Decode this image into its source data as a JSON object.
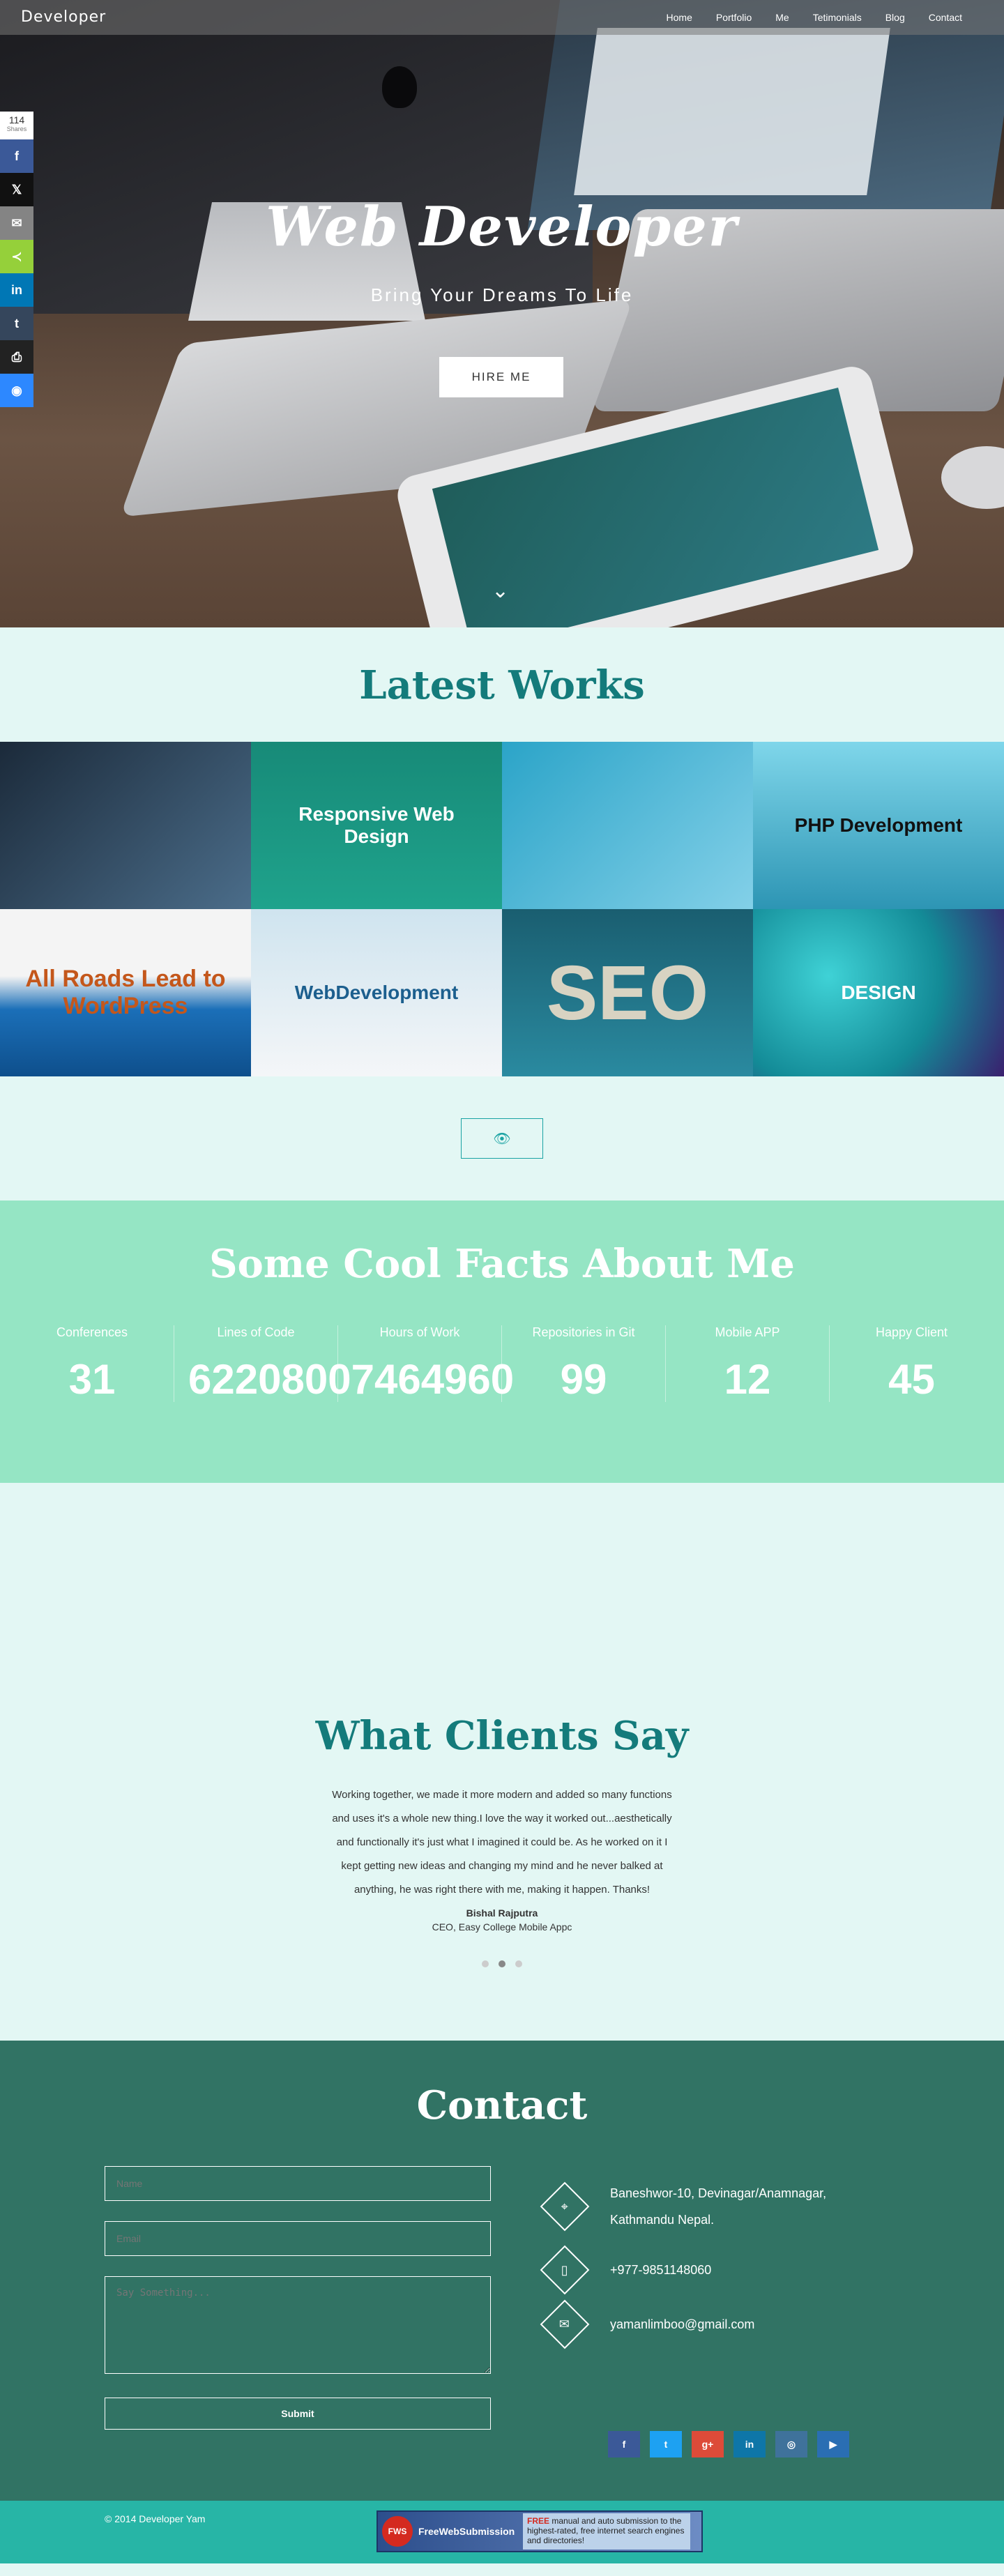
{
  "nav": {
    "brand": "Developer",
    "items": [
      "Home",
      "Portfolio",
      "Me",
      "Tetimonials",
      "Blog",
      "Contact"
    ]
  },
  "share": {
    "count": "114",
    "count_label": "Shares",
    "buttons": [
      {
        "icon": "facebook-icon",
        "glyph": "f",
        "color": "#3b5998"
      },
      {
        "icon": "x-icon",
        "glyph": "𝕏",
        "color": "#111111"
      },
      {
        "icon": "email-icon",
        "glyph": "✉",
        "color": "#848484"
      },
      {
        "icon": "share-icon",
        "glyph": "≺",
        "color": "#95d03a"
      },
      {
        "icon": "linkedin-icon",
        "glyph": "in",
        "color": "#0077b5"
      },
      {
        "icon": "tumblr-icon",
        "glyph": "t",
        "color": "#35465c"
      },
      {
        "icon": "print-icon",
        "glyph": "⎙",
        "color": "#222222"
      },
      {
        "icon": "messenger-icon",
        "glyph": "◉",
        "color": "#2d88ff"
      }
    ]
  },
  "hero": {
    "title": "Web Developer",
    "subtitle": "Bring Your Dreams To Life",
    "cta": "HIRE ME",
    "scroll_icon": "chevron-down-icon"
  },
  "works": {
    "title": "Latest Works",
    "tiles": [
      {
        "label": "",
        "bg": "linear-gradient(135deg,#1b2a3a,#4b6d8a)",
        "color": "#fff"
      },
      {
        "label": "Responsive Web Design",
        "bg": "linear-gradient(180deg,#178a78,#1fa38c)",
        "color": "#fff"
      },
      {
        "label": "",
        "bg": "linear-gradient(135deg,#2ba4c8,#83d0e8)",
        "color": "#fff"
      },
      {
        "label": "PHP Development",
        "bg": "linear-gradient(180deg,#7fd6ea,#2d95b4)",
        "color": "#111"
      },
      {
        "label": "All Roads Lead to WordPress",
        "bg": "linear-gradient(180deg,#f4f4f4 40%,#1b6fb8 60%,#0e4f8c)",
        "color": "#c4571b"
      },
      {
        "label": "WebDevelopment",
        "bg": "linear-gradient(180deg,#cfe4ef,#f4f6f8)",
        "color": "#1c5f8e"
      },
      {
        "label": "SEO",
        "bg": "linear-gradient(180deg,#1a5e70,#2a8aa0)",
        "color": "#d8d3c2"
      },
      {
        "label": "DESIGN",
        "bg": "radial-gradient(circle at 30% 40%,#3fd2d6,#138b97 55%,#3a1f6e)",
        "color": "#fff"
      }
    ],
    "view_icon": "eye-icon"
  },
  "facts": {
    "title": "Some Cool Facts About Me",
    "items": [
      {
        "label": "Conferences",
        "value": "31"
      },
      {
        "label": "Lines of Code",
        "value": "62208007464960"
      },
      {
        "label": "Hours of Work",
        "value": ""
      },
      {
        "label": "Repositories in Git",
        "value": "99"
      },
      {
        "label": "Mobile APP",
        "value": "12"
      },
      {
        "label": "Happy Client",
        "value": "45"
      }
    ]
  },
  "clients": {
    "title": "What Clients Say",
    "quote": "Working together, we made it more modern and added so many functions and uses it's a whole new thing.I love the way it worked out...aesthetically and functionally it's just what I imagined it could be. As he worked on it I kept getting new ideas and changing my mind and he never balked at anything, he was right there with me, making it happen. Thanks!",
    "name": "Bishal Rajputra",
    "role": "CEO, Easy College Mobile Appc"
  },
  "contact": {
    "title": "Contact",
    "name_placeholder": "Name",
    "email_placeholder": "Email",
    "message_placeholder": "Say Something...",
    "submit": "Submit",
    "address_line1": "Baneshwor-10, Devinagar/Anamnagar,",
    "address_line2": "Kathmandu Nepal.",
    "phone": "+977-9851148060",
    "email": "yamanlimboo@gmail.com",
    "socials": [
      {
        "icon": "facebook-icon",
        "glyph": "f",
        "color": "#3b5998"
      },
      {
        "icon": "twitter-icon",
        "glyph": "t",
        "color": "#1da1f2"
      },
      {
        "icon": "google-plus-icon",
        "glyph": "g+",
        "color": "#dd4b39"
      },
      {
        "icon": "linkedin-icon",
        "glyph": "in",
        "color": "#0e76a8"
      },
      {
        "icon": "instagram-icon",
        "glyph": "◎",
        "color": "#3f729b"
      },
      {
        "icon": "youtube-icon",
        "glyph": "▶",
        "color": "#2a6eb3"
      }
    ]
  },
  "footer": {
    "copyright": "© 2014 Developer Yam",
    "banner_logo": "FWS",
    "banner_name": "FreeWebSubmission",
    "banner_free": "FREE",
    "banner_text": "manual and auto submission to the highest-rated, free internet search engines and directories!"
  }
}
